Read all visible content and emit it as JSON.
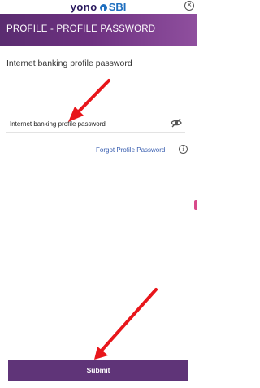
{
  "brand": {
    "logo_yono": "yono",
    "logo_sbi": "SBI"
  },
  "header": {
    "title": "PROFILE - PROFILE PASSWORD"
  },
  "close_symbol": "×",
  "form": {
    "heading": "Internet banking profile password",
    "password_placeholder": "Internet banking profile password",
    "forgot_link": "Forgot Profile Password",
    "info_symbol": "i"
  },
  "actions": {
    "submit_label": "Submit"
  },
  "icons": {
    "close": "close-icon",
    "eye": "eye-slash-icon",
    "info": "info-icon"
  },
  "colors": {
    "header_gradient_start": "#5a2c70",
    "header_gradient_end": "#8f4f9e",
    "submit_button": "#5f3478",
    "link": "#3a5fb0",
    "annotation_arrow": "#e8161b"
  }
}
